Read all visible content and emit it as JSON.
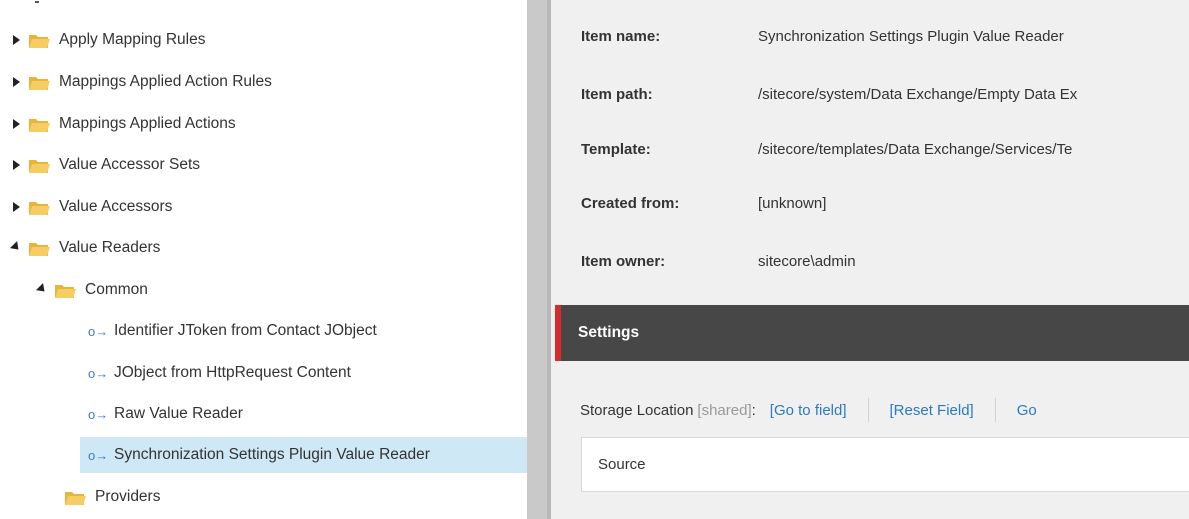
{
  "tree": {
    "items": [
      {
        "label": "Apply Mapping Rules",
        "icon": "folder-icon",
        "expander": "collapsed"
      },
      {
        "label": "Mappings Applied Action Rules",
        "icon": "folder-icon",
        "expander": "collapsed"
      },
      {
        "label": "Mappings Applied Actions",
        "icon": "folder-icon",
        "expander": "collapsed"
      },
      {
        "label": "Value Accessor Sets",
        "icon": "folder-icon",
        "expander": "collapsed"
      },
      {
        "label": "Value Accessors",
        "icon": "folder-icon",
        "expander": "collapsed"
      },
      {
        "label": "Value Readers",
        "icon": "folder-icon",
        "expander": "expanded"
      },
      {
        "label": "Common",
        "icon": "folder-icon",
        "expander": "expanded"
      },
      {
        "label": "Identifier JToken from Contact JObject",
        "icon": "key-icon"
      },
      {
        "label": "JObject from HttpRequest Content",
        "icon": "key-icon"
      },
      {
        "label": "Raw Value Reader",
        "icon": "key-icon"
      },
      {
        "label": "Synchronization Settings Plugin Value Reader",
        "icon": "key-icon",
        "selected": true
      },
      {
        "label": "Providers",
        "icon": "folder-icon"
      }
    ]
  },
  "info": {
    "item_name_label": "Item name:",
    "item_name": "Synchronization Settings Plugin Value Reader",
    "item_path_label": "Item path:",
    "item_path": "/sitecore/system/Data Exchange/Empty Data Ex",
    "template_label": "Template:",
    "template": "/sitecore/templates/Data Exchange/Services/Te",
    "created_from_label": "Created from:",
    "created_from": "[unknown]",
    "item_owner_label": "Item owner:",
    "item_owner": "sitecore\\admin"
  },
  "section": {
    "title": "Settings"
  },
  "field": {
    "name": "Storage Location",
    "shared": "[shared]",
    "colon": ":",
    "go_to_field": "[Go to field]",
    "reset_field": "[Reset Field]",
    "more_link": "Go",
    "value": "Source"
  },
  "colors": {
    "selected_row": "#cfe8f5",
    "section_bar": "#474747",
    "section_accent": "#d92b2b",
    "link": "#2b7ac6",
    "folder": "#f2c14e"
  }
}
